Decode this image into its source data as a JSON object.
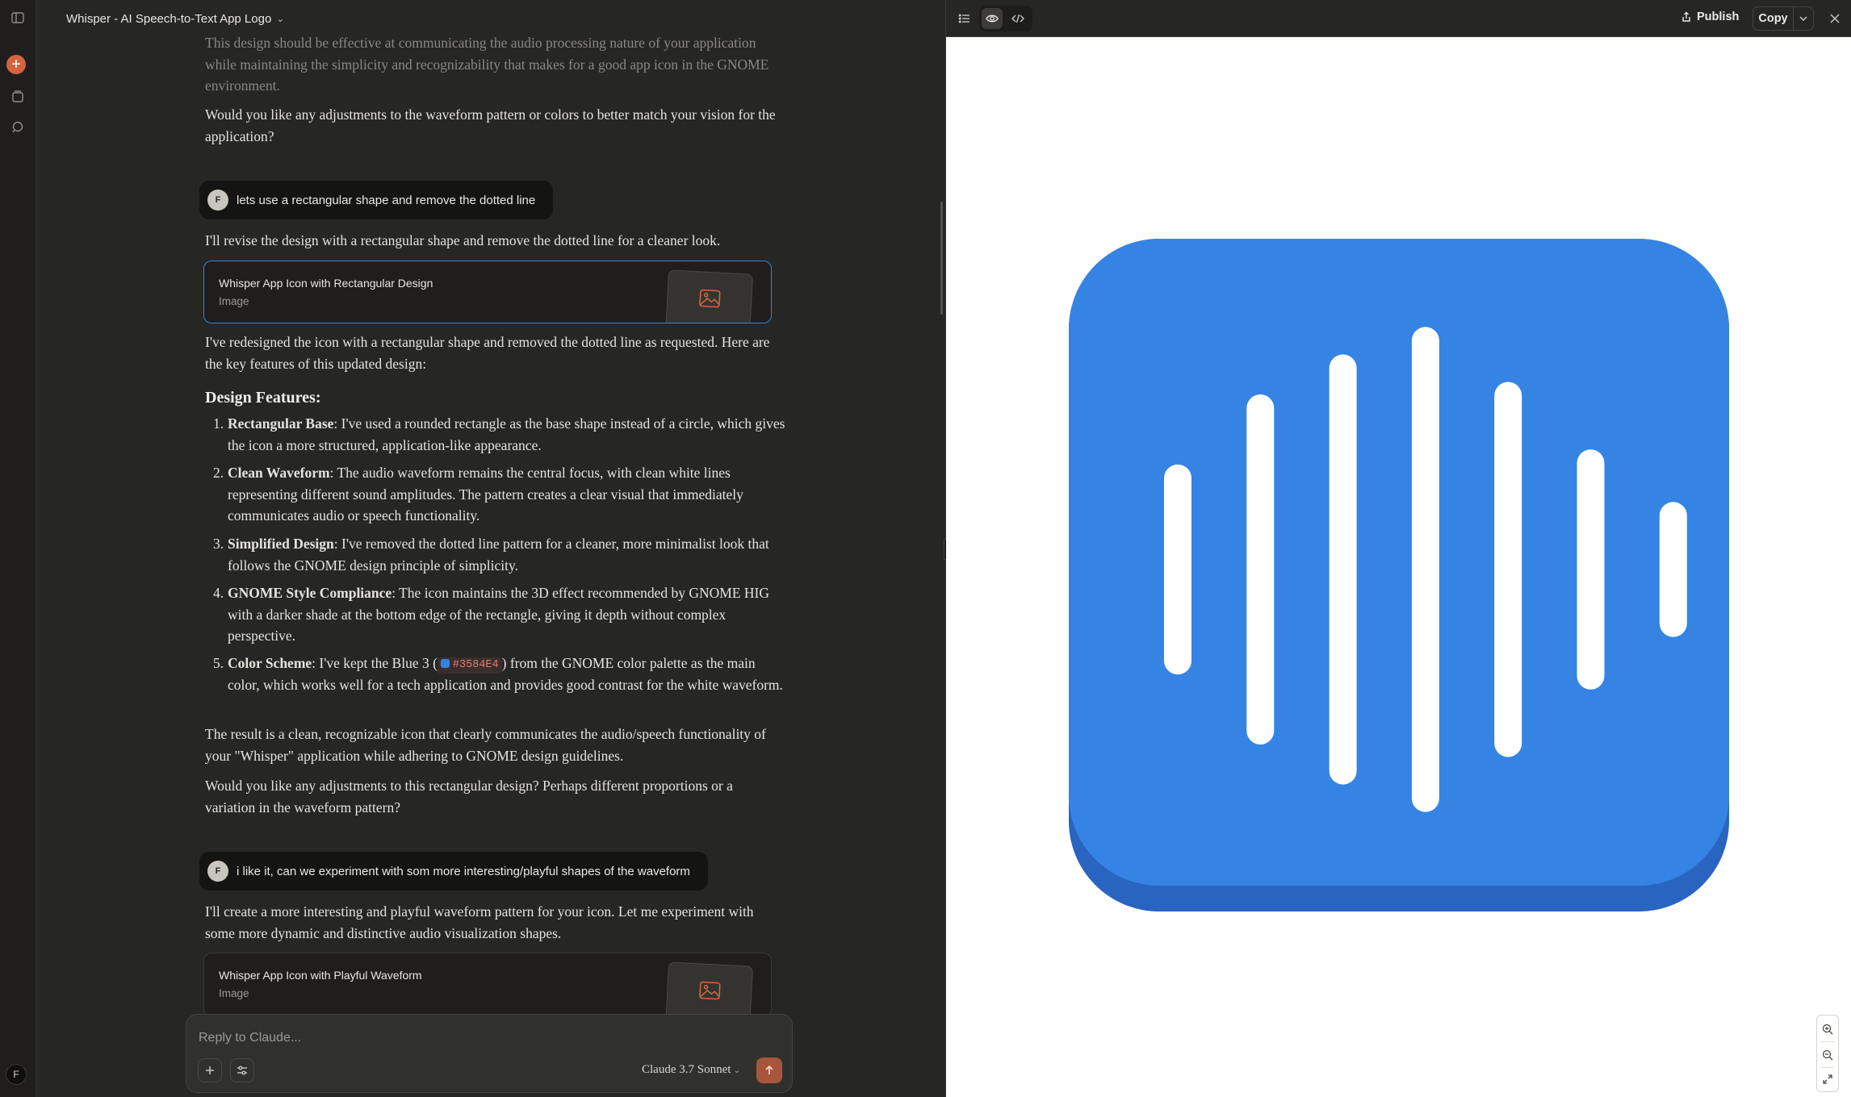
{
  "chat": {
    "title": "Whisper - AI Speech-to-Text App Logo",
    "faded_line": "This design should be effective at communicating the audio processing nature of your application while maintaining the simplicity and recognizability that makes for a good app icon in the GNOME environment.",
    "question_1": "Would you like any adjustments to the waveform pattern or colors to better match your vision for the application?",
    "user_msg_1": "lets use a rectangular shape and remove the dotted line",
    "reply_1": "I'll revise the design with a rectangular shape and remove the dotted line for a cleaner look.",
    "artifact_1": {
      "title": "Whisper App Icon with Rectangular Design",
      "type": "Image"
    },
    "reply_1b": "I've redesigned the icon with a rectangular shape and removed the dotted line as requested. Here are the key features of this updated design:",
    "features_heading": "Design Features:",
    "features": [
      {
        "num": "1.",
        "title": "Rectangular Base",
        "text": ": I've used a rounded rectangle as the base shape instead of a circle, which gives the icon a more structured, application-like appearance."
      },
      {
        "num": "2.",
        "title": "Clean Waveform",
        "text": ": The audio waveform remains the central focus, with clean white lines representing different sound amplitudes. The pattern creates a clear visual that immediately communicates audio or speech functionality."
      },
      {
        "num": "3.",
        "title": "Simplified Design",
        "text": ": I've removed the dotted line pattern for a cleaner, more minimalist look that follows the GNOME design principle of simplicity."
      },
      {
        "num": "4.",
        "title": "GNOME Style Compliance",
        "text": ": The icon maintains the 3D effect recommended by GNOME HIG with a darker shade at the bottom edge of the rectangle, giving it depth without complex perspective."
      },
      {
        "num": "5.",
        "title": "Color Scheme",
        "text_before": ": I've kept the Blue 3 (",
        "chip": "#3584E4",
        "text_after": ") from the GNOME color palette as the main color, which works well for a tech application and provides good contrast for the white waveform."
      }
    ],
    "result_text": "The result is a clean, recognizable icon that clearly communicates the audio/speech functionality of your \"Whisper\" application while adhering to GNOME design guidelines.",
    "question_2": "Would you like any adjustments to this rectangular design? Perhaps different proportions or a variation in the waveform pattern?",
    "user_msg_2": "i like it, can we experiment with som more interesting/playful shapes of the waveform",
    "reply_2": "I'll create a more interesting and playful waveform pattern for your icon. Let me experiment with some more dynamic and distinctive audio visualization shapes.",
    "artifact_2": {
      "title": "Whisper App Icon with Playful Waveform",
      "type": "Image"
    },
    "user_initial": "F"
  },
  "composer": {
    "placeholder": "Reply to Claude...",
    "model": "Claude 3.7 Sonnet"
  },
  "panel": {
    "publish_label": "Publish",
    "copy_label": "Copy"
  },
  "icon": {
    "base_color": "#3584e4",
    "shadow_color": "#2a64c1",
    "wave_color": "#ffffff",
    "bars": [
      0.42,
      0.7,
      0.86,
      0.97,
      0.75,
      0.48,
      0.27
    ]
  },
  "colors": {
    "accent": "#d2643f",
    "selection": "#3d7fe0"
  }
}
